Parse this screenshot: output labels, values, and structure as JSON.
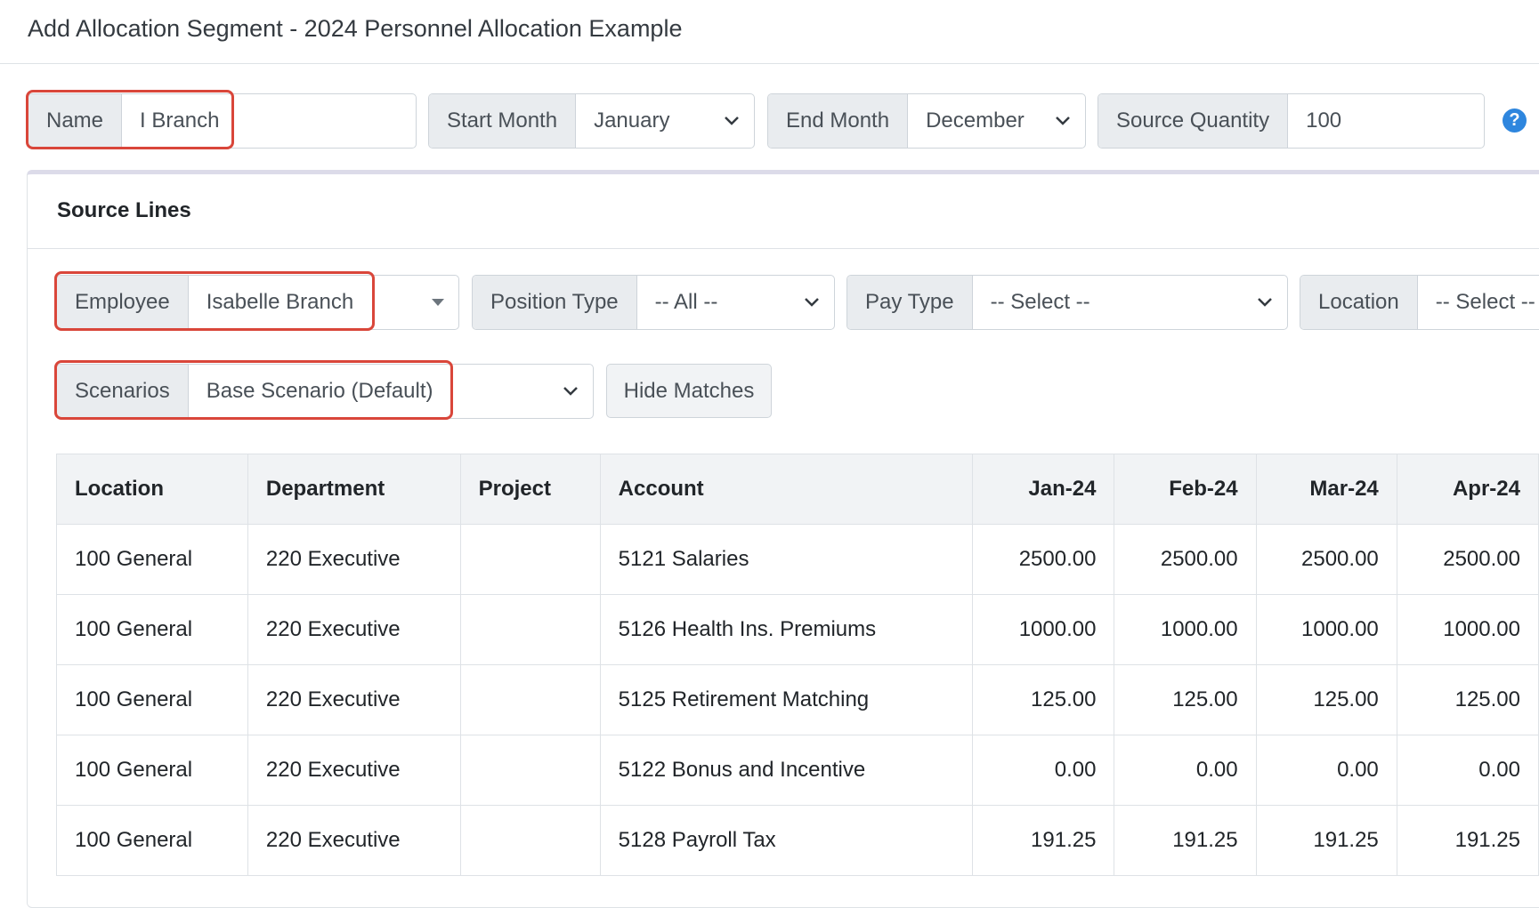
{
  "page": {
    "title": "Add Allocation Segment - 2024 Personnel Allocation Example"
  },
  "segment_form": {
    "name": {
      "label": "Name",
      "value": "I Branch"
    },
    "start_month": {
      "label": "Start Month",
      "value": "January"
    },
    "end_month": {
      "label": "End Month",
      "value": "December"
    },
    "source_quantity": {
      "label": "Source Quantity",
      "value": "100"
    },
    "help_icon": "?"
  },
  "source_lines": {
    "title": "Source Lines",
    "filters": {
      "employee": {
        "label": "Employee",
        "value": "Isabelle Branch"
      },
      "position_type": {
        "label": "Position Type",
        "value": "-- All --"
      },
      "pay_type": {
        "label": "Pay Type",
        "value": "-- Select --"
      },
      "location": {
        "label": "Location",
        "value": "-- Select --"
      },
      "scenarios": {
        "label": "Scenarios",
        "value": "Base Scenario (Default)"
      },
      "hide_matches_label": "Hide Matches"
    },
    "table": {
      "columns": [
        "Location",
        "Department",
        "Project",
        "Account",
        "Jan-24",
        "Feb-24",
        "Mar-24",
        "Apr-24"
      ],
      "rows": [
        [
          "100 General",
          "220 Executive",
          "",
          "5121 Salaries",
          "2500.00",
          "2500.00",
          "2500.00",
          "2500.00"
        ],
        [
          "100 General",
          "220 Executive",
          "",
          "5126 Health Ins. Premiums",
          "1000.00",
          "1000.00",
          "1000.00",
          "1000.00"
        ],
        [
          "100 General",
          "220 Executive",
          "",
          "5125 Retirement Matching",
          "125.00",
          "125.00",
          "125.00",
          "125.00"
        ],
        [
          "100 General",
          "220 Executive",
          "",
          "5122 Bonus and Incentive",
          "0.00",
          "0.00",
          "0.00",
          "0.00"
        ],
        [
          "100 General",
          "220 Executive",
          "",
          "5128 Payroll Tax",
          "191.25",
          "191.25",
          "191.25",
          "191.25"
        ]
      ]
    }
  },
  "colors": {
    "highlight": "#d9463a",
    "help_icon": "#2e86de",
    "addon_bg": "#e9ecef"
  }
}
